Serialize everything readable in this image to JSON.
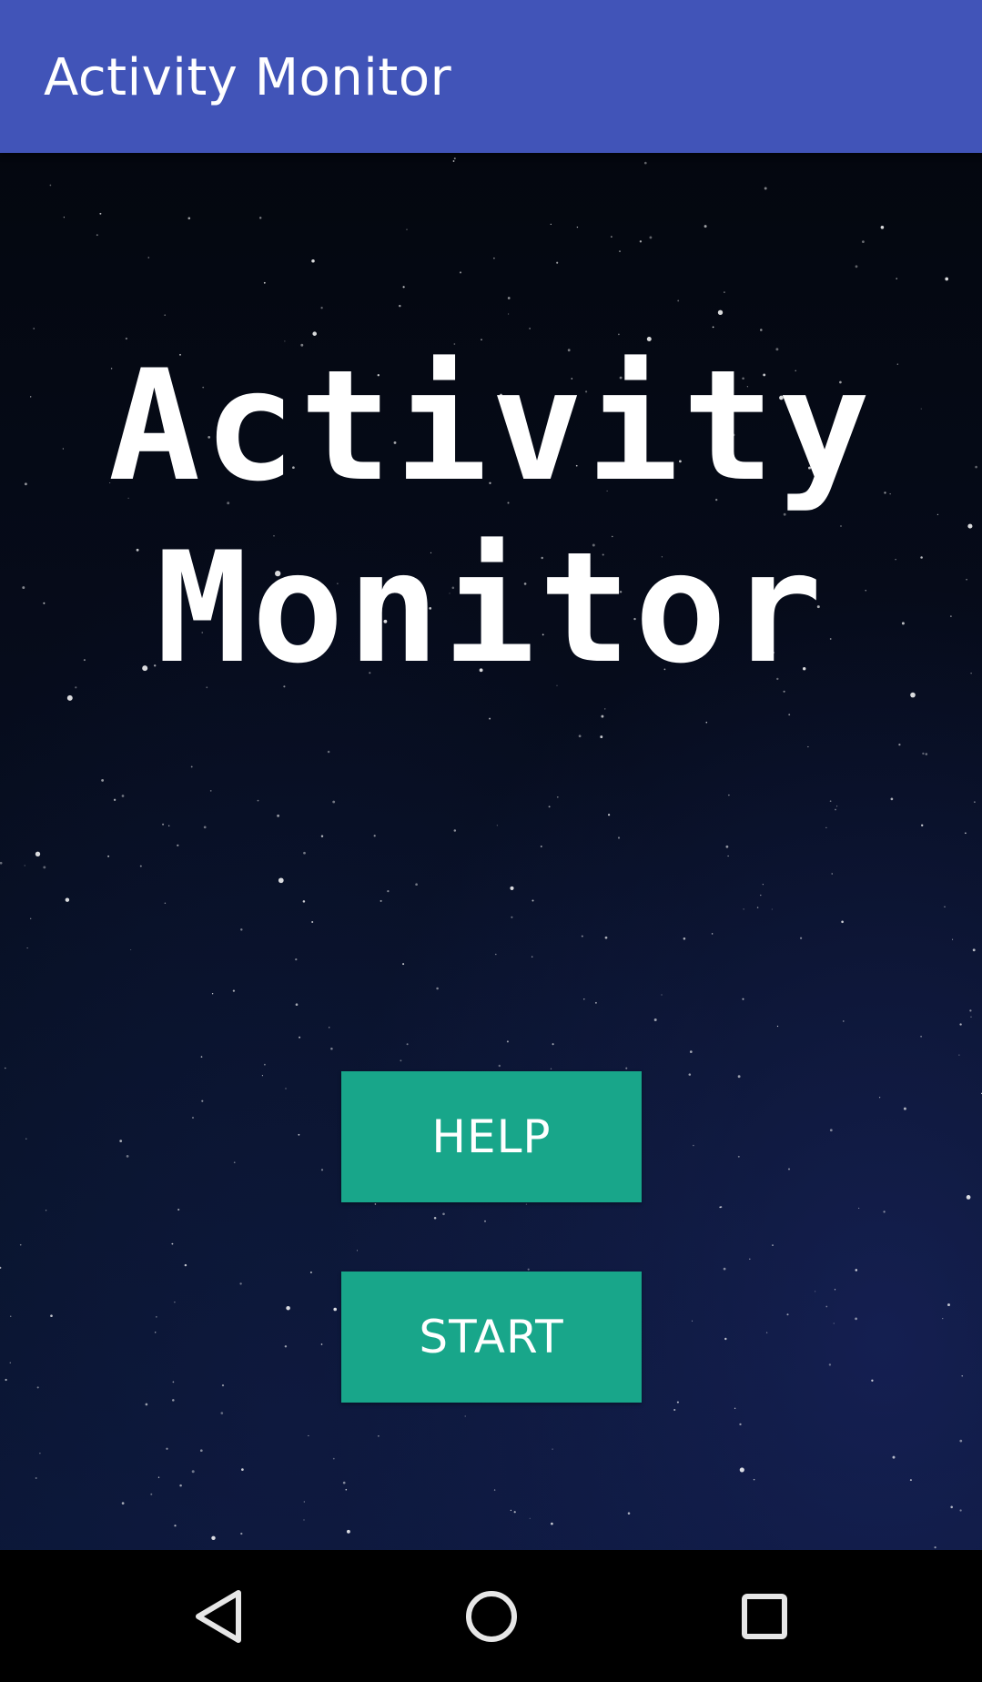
{
  "app_bar": {
    "title": "Activity Monitor",
    "color": "#4154b8"
  },
  "hero": {
    "line1": "Activity",
    "line2": "Monitor"
  },
  "buttons": {
    "help_label": "HELP",
    "start_label": "START",
    "color": "#18a68a"
  },
  "nav_bar": {
    "back_icon": "back-triangle-icon",
    "home_icon": "home-circle-icon",
    "recents_icon": "recents-square-icon"
  },
  "background": {
    "description_icon": "starfield"
  }
}
